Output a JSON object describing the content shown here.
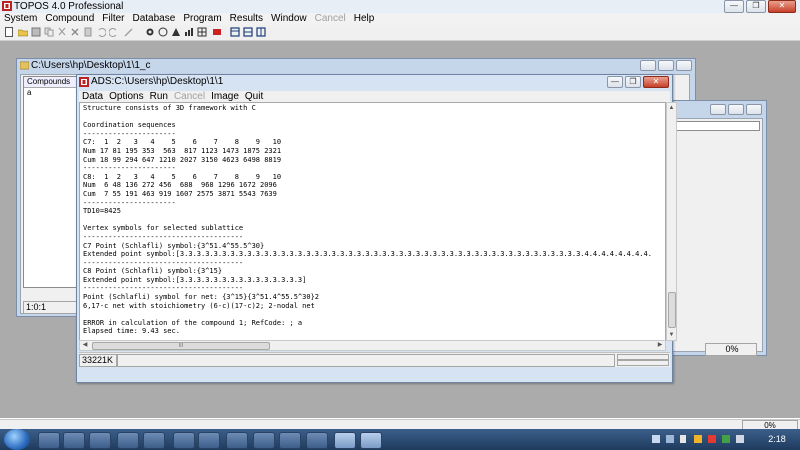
{
  "app": {
    "title": "TOPOS 4.0 Professional",
    "menu": [
      "System",
      "Compound",
      "Filter",
      "Database",
      "Program",
      "Results",
      "Window",
      "Cancel",
      "Help"
    ],
    "menu_disabled_index": 7
  },
  "compound_window": {
    "title": "C:\\Users\\hp\\Desktop\\1\\1_c",
    "list_header": "Compounds",
    "list_item": "a",
    "status": "1:0:1"
  },
  "right_window": {
    "status_percent": "0%"
  },
  "ads_window": {
    "title": "ADS:C:\\Users\\hp\\Desktop\\1\\1",
    "menu": [
      "Data",
      "Options",
      "Run",
      "Cancel",
      "Image",
      "Quit"
    ],
    "menu_disabled_index": 3,
    "output_lines": [
      "Structure consists of 3D framework with C",
      "",
      "Coordination sequences",
      "----------------------",
      "C7:  1  2   3   4    5    6    7    8    9   10",
      "Num 17 81 195 353  563  817 1123 1473 1875 2321",
      "Cum 18 99 294 647 1210 2027 3150 4623 6498 8819",
      "----------------------",
      "C8:  1  2   3   4    5    6    7    8    9   10",
      "Num  6 48 136 272 456  688  968 1296 1672 2096",
      "Cum  7 55 191 463 919 1607 2575 3871 5543 7639",
      "----------------------",
      "TD10=8425",
      "",
      "Vertex symbols for selected sublattice",
      "--------------------------------------",
      "C7 Point (Schlafli) symbol:{3^51.4^55.5^30}",
      "Extended point symbol:[3.3.3.3.3.3.3.3.3.3.3.3.3.3.3.3.3.3.3.3.3.3.3.3.3.3.3.3.3.3.3.3.3.3.3.3.3.3.3.3.3.3.3.3.3.3.3.3.4.4.4.4.4.4.4.4.",
      "--------------------------------------",
      "C8 Point (Schlafli) symbol:{3^15}",
      "Extended point symbol:[3.3.3.3.3.3.3.3.3.3.3.3.3.3.3]",
      "--------------------------------------",
      "Point (Schlafli) symbol for net: {3^15}{3^51.4^55.5^30}2",
      "6,17-c net with stoichiometry (6-c)(17-c)2; 2-nodal net",
      "",
      "ERROR in calculation of the compound 1; RefCode: ; a",
      "Elapsed time: 9.43 sec."
    ],
    "status_memory": "33221K",
    "hscroll_grip": "III"
  },
  "main_status": {
    "percent": "0%"
  },
  "taskbar": {
    "time": "2:18"
  }
}
